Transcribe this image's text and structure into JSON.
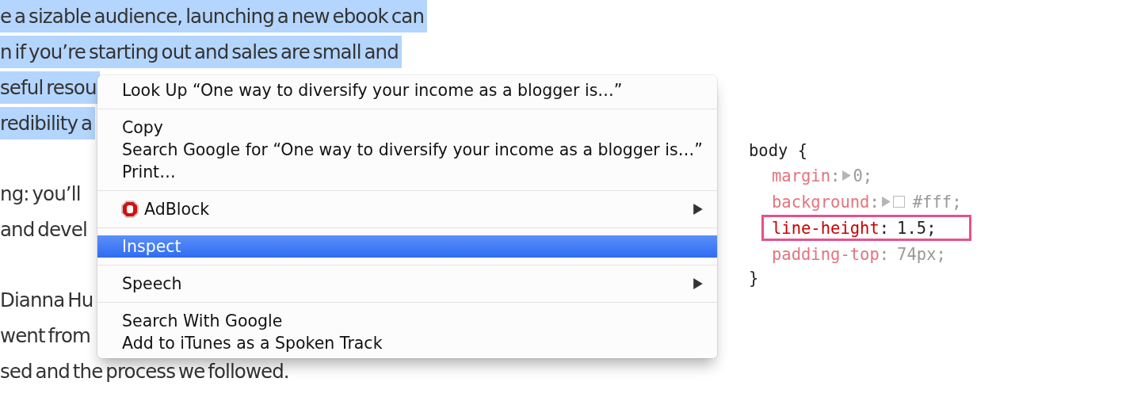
{
  "article": {
    "paragraphs": [
      [
        "e a sizable audience, launching a new ebook can",
        "n if you’re starting out and sales are small and",
        "seful resou",
        "redibility a"
      ],
      [
        "ng: you’ll",
        "and devel"
      ],
      [
        "Dianna Hu",
        "went from",
        "sed and the process we followed."
      ]
    ],
    "selected_lines": [
      true,
      true,
      true,
      true
    ]
  },
  "context_menu": {
    "groups": [
      [
        {
          "label": "Look Up “One way to diversify your income as a blogger is…”",
          "submenu": false,
          "selected": false
        }
      ],
      [
        {
          "label": "Copy",
          "submenu": false,
          "selected": false
        },
        {
          "label": "Search Google for “One way to diversify your income as a blogger is…”",
          "submenu": false,
          "selected": false
        },
        {
          "label": "Print…",
          "submenu": false,
          "selected": false
        }
      ],
      [
        {
          "label": "AdBlock",
          "kind": "adblock",
          "submenu": true,
          "selected": false
        }
      ],
      [
        {
          "label": "Inspect",
          "submenu": false,
          "selected": true
        }
      ],
      [
        {
          "label": "Speech",
          "submenu": true,
          "selected": false
        }
      ],
      [
        {
          "label": "Search With Google",
          "submenu": false,
          "selected": false
        },
        {
          "label": "Add to iTunes as a Spoken Track",
          "submenu": false,
          "selected": false
        }
      ]
    ]
  },
  "css_rule": {
    "selector": "body {",
    "close": "}",
    "properties": [
      {
        "name": "margin",
        "colon": ":",
        "value": "0;",
        "expandable": true,
        "swatch": false,
        "highlighted": false
      },
      {
        "name": "background",
        "colon": ":",
        "value": "#fff;",
        "expandable": true,
        "swatch": true,
        "highlighted": false
      },
      {
        "name": "line-height",
        "colon": ":",
        "value": "1.5;",
        "expandable": false,
        "swatch": false,
        "highlighted": true
      },
      {
        "name": "padding-top",
        "colon": ":",
        "value": "74px;",
        "expandable": false,
        "swatch": false,
        "highlighted": false
      }
    ]
  }
}
